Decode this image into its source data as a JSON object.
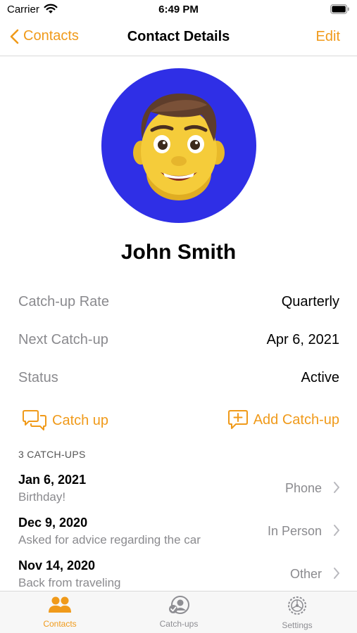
{
  "status_bar": {
    "carrier": "Carrier",
    "time": "6:49 PM"
  },
  "nav": {
    "back_label": "Contacts",
    "title": "Contact Details",
    "edit_label": "Edit"
  },
  "contact": {
    "name": "John Smith",
    "avatar_bg": "#2f2fe6",
    "avatar_icon": "memoji-avatar"
  },
  "info": [
    {
      "label": "Catch-up Rate",
      "value": "Quarterly"
    },
    {
      "label": "Next Catch-up",
      "value": "Apr 6, 2021"
    },
    {
      "label": "Status",
      "value": "Active"
    }
  ],
  "actions": {
    "catch_up": "Catch up",
    "add_catch_up": "Add Catch-up"
  },
  "section_header": "3 CATCH-UPS",
  "catchups": [
    {
      "date": "Jan 6, 2021",
      "note": "Birthday!",
      "type": "Phone"
    },
    {
      "date": "Dec 9, 2020",
      "note": "Asked for advice regarding the car",
      "type": "In Person"
    },
    {
      "date": "Nov 14, 2020",
      "note": "Back from traveling",
      "type": "Other"
    }
  ],
  "tabs": [
    {
      "label": "Contacts",
      "icon": "people-icon",
      "active": true
    },
    {
      "label": "Catch-ups",
      "icon": "person-check-icon",
      "active": false
    },
    {
      "label": "Settings",
      "icon": "gear-icon",
      "active": false
    }
  ],
  "colors": {
    "accent": "#f09a1a",
    "secondary_text": "#8a8a8e",
    "inactive_tab": "#8e8e93"
  }
}
